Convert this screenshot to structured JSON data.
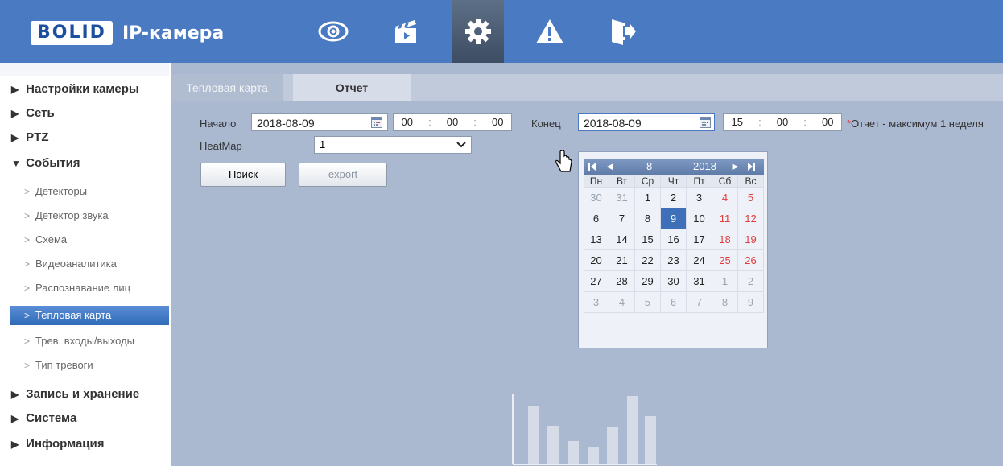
{
  "header": {
    "logo_box": "BOLID",
    "logo_text": "IP-камера",
    "nav_icons": [
      "eye-icon",
      "clapperboard-icon",
      "gear-icon",
      "warning-icon",
      "exit-icon"
    ],
    "active_icon": "gear-icon"
  },
  "sidebar": {
    "items": [
      {
        "label": "Настройки камеры"
      },
      {
        "label": "Сеть"
      },
      {
        "label": "PTZ"
      },
      {
        "label": "События"
      }
    ],
    "subitems": [
      {
        "label": "Детекторы"
      },
      {
        "label": "Детектор звука"
      },
      {
        "label": "Схема"
      },
      {
        "label": "Видеоаналитика"
      },
      {
        "label": "Распознавание лиц"
      },
      {
        "label": "Тепловая карта"
      },
      {
        "label": "Трев. входы/выходы"
      },
      {
        "label": "Тип тревоги"
      }
    ],
    "bottom_items": [
      {
        "label": "Запись и хранение"
      },
      {
        "label": "Система"
      },
      {
        "label": "Информация"
      }
    ],
    "arrow_closed": "▶",
    "arrow_open": "▼",
    "sub_chevron": ">"
  },
  "tabs": {
    "tab1": "Тепловая карта",
    "tab2": "Отчет"
  },
  "form": {
    "start_label": "Начало",
    "start_date": "2018-08-09",
    "start_h": "00",
    "start_m": "00",
    "start_s": "00",
    "end_label": "Конец",
    "end_date": "2018-08-09",
    "end_h": "15",
    "end_m": "00",
    "end_s": "00",
    "time_sep": ":",
    "note_star": "*",
    "note_text": "Отчет - максимум 1 неделя",
    "heatmap_label": "HeatMap",
    "heatmap_value": "1",
    "search_button": "Поиск",
    "export_button": "export"
  },
  "calendar": {
    "month": "8",
    "year": "2018",
    "prev_label": "◄",
    "next_label": "►",
    "weekdays": [
      "Пн",
      "Вт",
      "Ср",
      "Чт",
      "Пт",
      "Сб",
      "Вс"
    ],
    "weeks": [
      [
        "30",
        "31",
        "1",
        "2",
        "3",
        "4",
        "5"
      ],
      [
        "6",
        "7",
        "8",
        "9",
        "10",
        "11",
        "12"
      ],
      [
        "13",
        "14",
        "15",
        "16",
        "17",
        "18",
        "19"
      ],
      [
        "20",
        "21",
        "22",
        "23",
        "24",
        "25",
        "26"
      ],
      [
        "27",
        "28",
        "29",
        "30",
        "31",
        "1",
        "2"
      ],
      [
        "3",
        "4",
        "5",
        "6",
        "7",
        "8",
        "9"
      ]
    ],
    "selected": "9"
  },
  "colors": {
    "header_bg": "#4a7bc2",
    "panel_bg": "#aab8d0",
    "active_blue": "#3d70b8",
    "weekend_red": "#e23b3b"
  }
}
